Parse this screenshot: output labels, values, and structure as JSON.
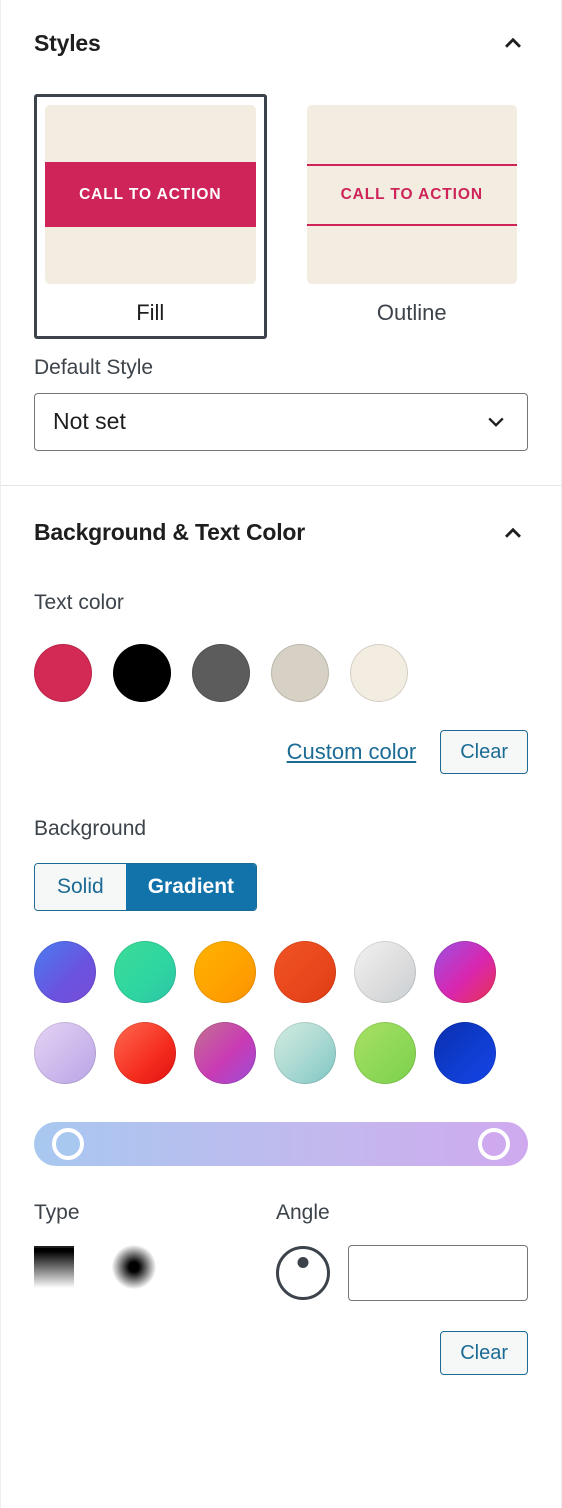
{
  "styles_panel": {
    "title": "Styles",
    "collapse_icon": "chevron-up-icon",
    "options": [
      {
        "name": "Fill",
        "cta_label": "CALL TO ACTION",
        "selected": true,
        "preview_bg": "#f2ece1",
        "button_bg": "#ce2459",
        "button_text": "#ffffff"
      },
      {
        "name": "Outline",
        "cta_label": "CALL TO ACTION",
        "selected": false,
        "preview_bg": "#f2ece1",
        "button_bg": "transparent",
        "button_text": "#ce2459",
        "button_border": "#ce2459"
      }
    ],
    "default_style": {
      "label": "Default Style",
      "value": "Not set",
      "caret_icon": "chevron-down-icon"
    }
  },
  "color_panel": {
    "title": "Background & Text Color",
    "collapse_icon": "chevron-up-icon",
    "text_color": {
      "label": "Text color",
      "swatches": [
        "#d32a55",
        "#000000",
        "#5c5c5c",
        "#d6d1c4",
        "#f2ece1"
      ],
      "custom_color_label": "Custom color",
      "clear_label": "Clear"
    },
    "background": {
      "label": "Background",
      "toggle": {
        "solid_label": "Solid",
        "gradient_label": "Gradient",
        "active": "Gradient"
      },
      "gradient_swatches": [
        "linear-gradient(135deg, #4a7df0 0%, #6a52e0 60%, #7a4fd6 100%)",
        "linear-gradient(135deg, #3ddc97 0%, #2fd6a0 55%, #2ec4a8 100%)",
        "linear-gradient(135deg, #ffb300 0%, #ffa200 55%, #fb9200 100%)",
        "linear-gradient(135deg, #f05423 0%, #e8461c 60%, #e03c14 100%)",
        "linear-gradient(135deg, #f2f2f2 0%, #dddddd 55%, #c9cfd3 100%)",
        "linear-gradient(135deg, #9b51e0 0%, #d926b0 55%, #e8344e 100%)",
        "linear-gradient(135deg, #e6d4f5 0%, #cdb9ec 55%, #b9a5e4 100%)",
        "linear-gradient(135deg, #ff6a50 0%, #f52d1f 60%, #e01010 100%)",
        "linear-gradient(135deg, #c2738f 0%, #c93ab5 55%, #9b4fd6 100%)",
        "linear-gradient(135deg, #d3ece0 0%, #a8d8d2 55%, #7ec6c2 100%)",
        "linear-gradient(135deg, #a8e063 0%, #8fd858 55%, #7ccf4d 100%)",
        "linear-gradient(135deg, #0b2fae 0%, #0f3dd0 55%, #1644e8 100%)"
      ],
      "gradient_bar": {
        "css": "linear-gradient(90deg, #a8c8f0 0%, #c3b8ee 60%, #cfa9ee 100%)",
        "stops": [
          {
            "position": 0,
            "color": "#a8c8f0"
          },
          {
            "position": 100,
            "color": "#cfa9ee"
          }
        ]
      },
      "type": {
        "label": "Type",
        "options": [
          "linear-gradient-icon",
          "radial-gradient-icon"
        ],
        "active": "linear-gradient-icon"
      },
      "angle": {
        "label": "Angle",
        "value": "",
        "dial_icon": "angle-dial-icon"
      },
      "clear_label": "Clear"
    }
  }
}
